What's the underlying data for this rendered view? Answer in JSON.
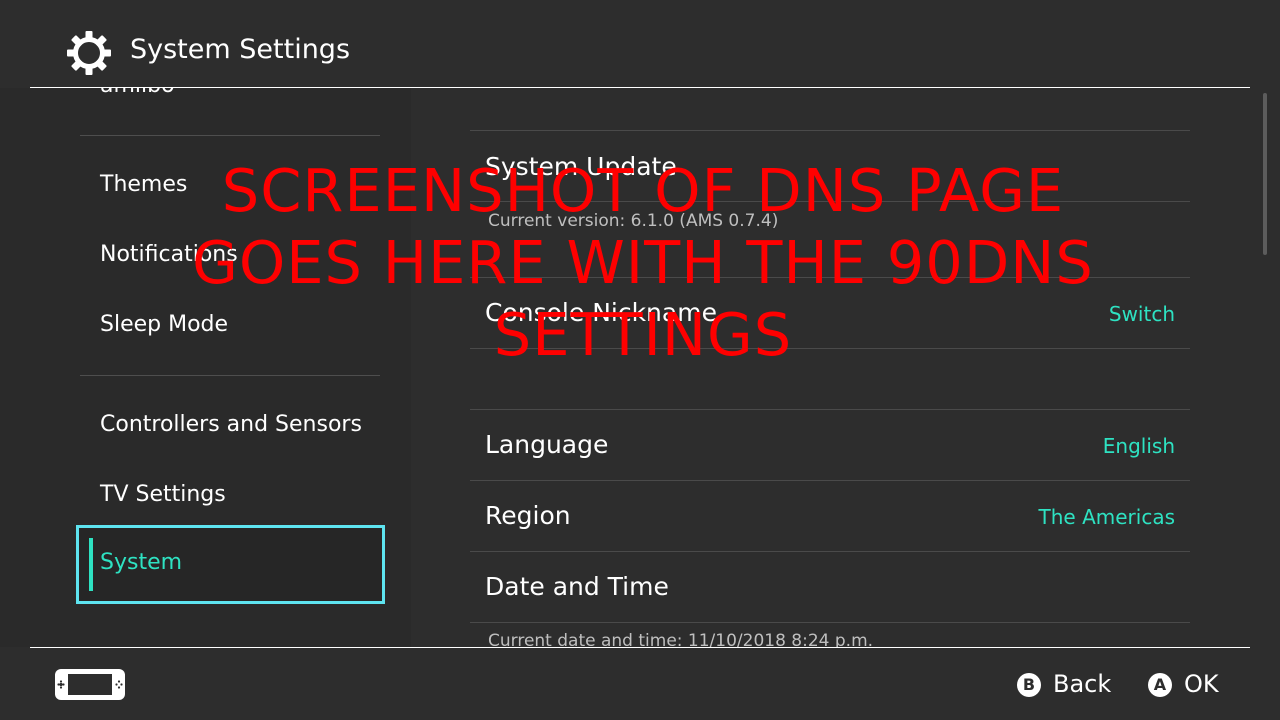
{
  "header": {
    "title": "System Settings",
    "icon": "gear-icon"
  },
  "sidebar": {
    "items": [
      {
        "label": "amiibo"
      },
      {
        "label": "Themes"
      },
      {
        "label": "Notifications"
      },
      {
        "label": "Sleep Mode"
      },
      {
        "label": "Controllers and Sensors"
      },
      {
        "label": "TV Settings"
      },
      {
        "label": "System",
        "selected": true
      }
    ]
  },
  "content": {
    "system_update": {
      "title": "System Update",
      "subtitle": "Current version: 6.1.0 (AMS 0.7.4)"
    },
    "console_nickname": {
      "title": "Console Nickname",
      "value": "Switch"
    },
    "language": {
      "title": "Language",
      "value": "English"
    },
    "region": {
      "title": "Region",
      "value": "The Americas"
    },
    "date_time": {
      "title": "Date and Time",
      "subtitle": "Current date and time: 11/10/2018 8:24 p.m."
    }
  },
  "overlay": {
    "line1": "SCREENSHOT OF DNS PAGE",
    "line2": "GOES HERE WITH THE 90DNS",
    "line3": "SETTINGS",
    "color": "#ff0000"
  },
  "footer": {
    "back": {
      "key": "B",
      "label": "Back"
    },
    "ok": {
      "key": "A",
      "label": "OK"
    }
  },
  "colors": {
    "accent": "#2ee2c2",
    "selection_border": "#5ee4f0",
    "background": "#2d2d2d"
  }
}
